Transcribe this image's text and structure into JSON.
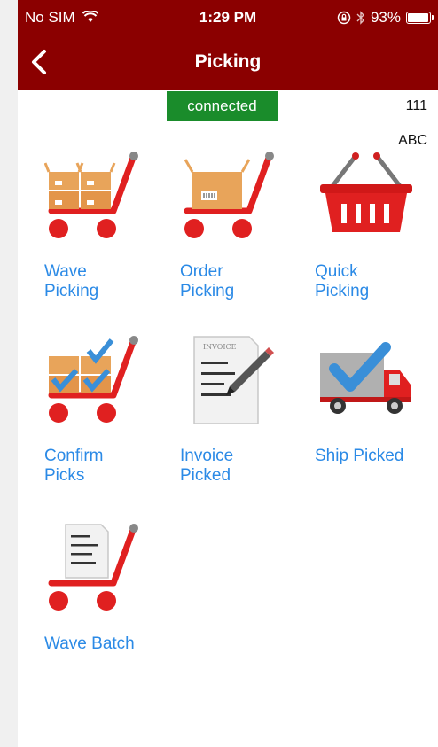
{
  "status_bar": {
    "carrier": "No SIM",
    "time": "1:29 PM",
    "battery": "93%",
    "icons": [
      "wifi-icon",
      "rotation-lock-icon",
      "bluetooth-icon",
      "battery-icon"
    ]
  },
  "nav": {
    "title": "Picking",
    "back_icon": "chevron-left-icon"
  },
  "connection": {
    "label": "connected",
    "color": "#1a8c2b"
  },
  "meta": {
    "number": "111",
    "code": "ABC"
  },
  "tiles": [
    {
      "label": "Wave\nPicking",
      "icon": "wave-picking-cart-icon"
    },
    {
      "label": "Order\nPicking",
      "icon": "order-picking-cart-icon"
    },
    {
      "label": "Quick\nPicking",
      "icon": "basket-icon"
    },
    {
      "label": "Confirm\nPicks",
      "icon": "confirm-picks-cart-icon"
    },
    {
      "label": "Invoice\nPicked",
      "icon": "invoice-icon"
    },
    {
      "label": "Ship Picked",
      "icon": "delivery-truck-icon"
    },
    {
      "label": "Wave Batch",
      "icon": "wave-batch-cart-icon"
    }
  ],
  "colors": {
    "header": "#8b0000",
    "link": "#2b8ae6",
    "cart_red": "#e02020"
  }
}
